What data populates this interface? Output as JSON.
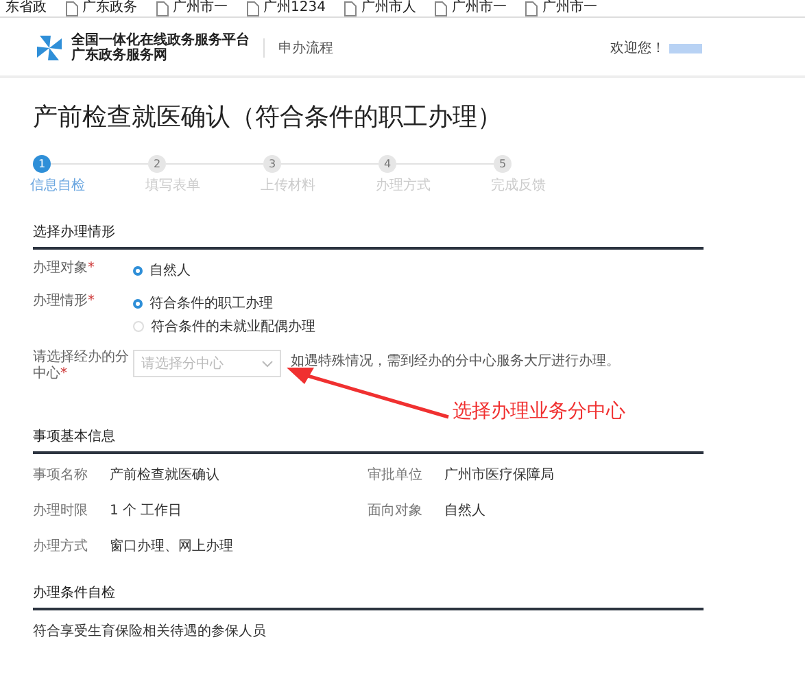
{
  "bookmarks": [
    "东省政",
    "广东政务",
    "广州市一",
    "广州1234",
    "广州市人",
    "广州市一",
    "广州市一"
  ],
  "header": {
    "site_title": "全国一体化在线政务服务平台",
    "site_subtitle": "广东政务服务网",
    "nav": "申办流程",
    "welcome": "欢迎您！"
  },
  "page_title": "产前检查就医确认（符合条件的职工办理）",
  "steps": [
    {
      "number": "1",
      "label": "信息自检",
      "selected": true
    },
    {
      "number": "2",
      "label": "填写表单",
      "selected": false
    },
    {
      "number": "3",
      "label": "上传材料",
      "selected": false
    },
    {
      "number": "4",
      "label": "办理方式",
      "selected": false
    },
    {
      "number": "5",
      "label": "完成反馈",
      "selected": false
    }
  ],
  "situation": {
    "heading": "选择办理情形",
    "fields": [
      {
        "label": "办理对象",
        "required_mark": "*",
        "kind": "radio",
        "options": [
          {
            "label": "自然人",
            "selected": true
          }
        ]
      },
      {
        "label": "办理情形",
        "required_mark": "*",
        "kind": "radio",
        "options": [
          {
            "label": "符合条件的职工办理",
            "selected": true
          },
          {
            "label": "符合条件的未就业配偶办理",
            "selected": false
          }
        ]
      },
      {
        "label": "请选择经办的分中心",
        "required_mark": "*",
        "kind": "select",
        "placeholder": "请选择分中心",
        "hint": "如遇特殊情况，需到经办的分中心服务大厅进行办理。"
      }
    ]
  },
  "annotation": "选择办理业务分中心",
  "basic_info": {
    "heading": "事项基本信息",
    "rows": [
      [
        {
          "label": "事项名称",
          "value": "产前检查就医确认"
        },
        {
          "label": "审批单位",
          "value": "广州市医疗保障局"
        }
      ],
      [
        {
          "label": "办理时限",
          "value": "1 个 工作日"
        },
        {
          "label": "面向对象",
          "value": "自然人"
        }
      ],
      [
        {
          "label": "办理方式",
          "value": "窗口办理、网上办理"
        }
      ]
    ]
  },
  "conditions": {
    "heading": "办理条件自检",
    "text": "符合享受生育保险相关待遇的参保人员"
  }
}
